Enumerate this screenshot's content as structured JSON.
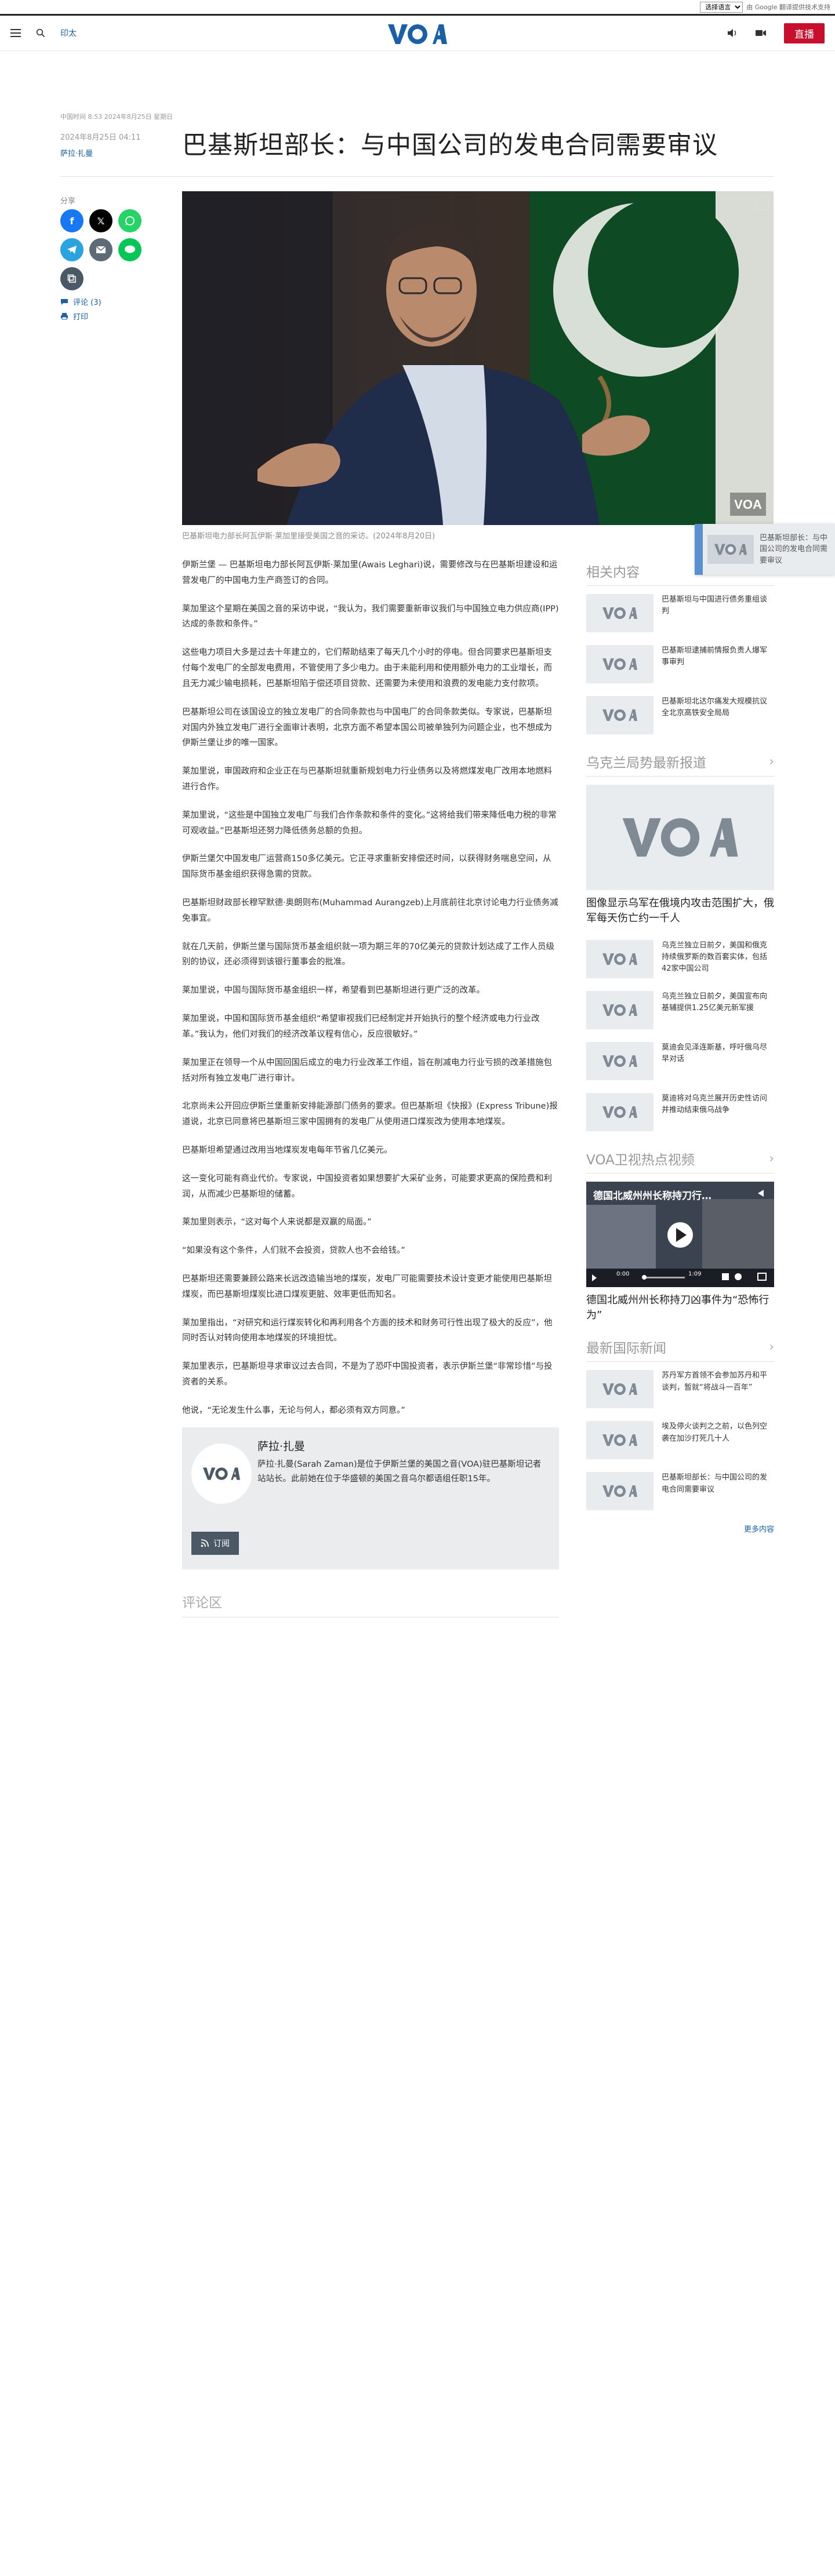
{
  "translate": {
    "select_label": "选择语言",
    "powered": "由 Google 翻译提供技术支持",
    "powered_brand": "翻译"
  },
  "header": {
    "print_label": "印太",
    "live_label": "直播",
    "logo_text": "VOA"
  },
  "meta": {
    "timezone_line": "中国时间 8:53 2024年8月25日 星期日",
    "date": "2024年8月25日 04:11",
    "author": "萨拉·扎曼"
  },
  "headline": "巴基斯坦部长：与中国公司的发电合同需要审议",
  "share": {
    "label": "分享",
    "comments": "评论 (3)",
    "print": "打印"
  },
  "hero_caption": "巴基斯坦电力部长阿瓦伊斯·莱加里接受美国之音的采访。(2024年8月20日)",
  "article": [
    "伊斯兰堡 — 巴基斯坦电力部长阿瓦伊斯·莱加里(Awais Leghari)说，需要修改与在巴基斯坦建设和运营发电厂的中国电力生产商签订的合同。",
    "莱加里这个星期在美国之音的采访中说，“我认为，我们需要重新审议我们与中国独立电力供应商(IPP)达成的条款和条件。”",
    "这些电力项目大多是过去十年建立的，它们帮助结束了每天几个小时的停电。但合同要求巴基斯坦支付每个发电厂的全部发电费用，不管使用了多少电力。由于未能利用和使用额外电力的工业增长，而且无力减少输电损耗，巴基斯坦陷于偿还项目贷款、还需要为未使用和浪费的发电能力支付款项。",
    "巴基斯坦公司在该国设立的独立发电厂的合同条款也与中国电厂的合同条款类似。专家说，巴基斯坦对国内外独立发电厂进行全面审计表明，北京方面不希望本国公司被单独列为问题企业，也不想成为伊斯兰堡让步的唯一国家。",
    "莱加里说，审国政府和企业正在与巴基斯坦就重新规划电力行业债务以及将燃煤发电厂改用本地燃料进行合作。",
    "莱加里说，“这些是中国独立发电厂与我们合作条款和条件的变化。”这将给我们带来降低电力税的非常可观收益。”巴基斯坦还努力降低债务总额的负担。",
    "伊斯兰堡欠中国发电厂运营商150多亿美元。它正寻求重新安排偿还时间，以获得财务喘息空间，从国际货币基金组织获得急需的贷款。",
    "巴基斯坦财政部长穆罕默德·奥朗则布(Muhammad Aurangzeb)上月底前往北京讨论电力行业债务减免事宜。",
    "就在几天前，伊斯兰堡与国际货币基金组织就一项为期三年的70亿美元的贷款计划达成了工作人员级别的协议，还必须得到该银行董事会的批准。",
    "莱加里说，中国与国际货币基金组织一样，希望看到巴基斯坦进行更广泛的改革。",
    "莱加里说，中国和国际货币基金组织“希望审视我们已经制定并开始执行的整个经济或电力行业改革。”我认为，他们对我们的经济改革议程有信心，反应很敏好。”",
    "莱加里正在领导一个从中国回国后成立的电力行业改革工作组，旨在削减电力行业亏损的改革措施包括对所有独立发电厂进行审计。",
    "北京尚未公开回应伊斯兰堡重新安排能源部门债务的要求。但巴基斯坦《快报》(Express Tribune)报道说，北京已同意将巴基斯坦三家中国拥有的发电厂从使用进口煤炭改为使用本地煤炭。",
    "巴基斯坦希望通过改用当地煤炭发电每年节省几亿美元。",
    "这一变化可能有商业代价。专家说，中国投资者如果想要扩大采矿业务，可能要求更高的保险费和利润，从而减少巴基斯坦的储蓄。",
    "莱加里则表示，“这对每个人来说都是双赢的局面。”",
    "“如果没有这个条件，人们就不会投资，贷款人也不会给钱。”",
    "巴基斯坦还需要兼顾公路来长远改造输当地的煤炭，发电厂可能需要技术设计变更才能使用巴基斯坦煤炭，而巴基斯坦煤炭比进口煤炭更脏、效率更低而知名。",
    "莱加里指出，“对研究和运行煤炭转化和再利用各个方面的技术和财务可行性出现了极大的反应”，他同时否认对转向使用本地煤炭的环境担忧。",
    "莱加里表示，巴基斯坦寻求审议过去合同，不是为了恐吓中国投资者，表示伊斯兰堡“非常珍惜”与投资者的关系。",
    "他说，“无论发生什么事，无论与何人，都必须有双方同意。”"
  ],
  "bio": {
    "name": "萨拉·扎曼",
    "text": "萨拉·扎曼(Sarah Zaman)是位于伊斯兰堡的美国之音(VOA)驻巴基斯坦记者站站长。此前她在位于华盛顿的美国之音乌尔都语组任职15年。",
    "subscribe": "订阅"
  },
  "comments_title": "评论区",
  "sidebar": {
    "related_title": "相关内容",
    "related": [
      "巴基斯坦与中国进行债务重组谈判",
      "巴基斯坦逮捕前情报负责人爆军事审判",
      "巴基斯坦北达尔痛发大规模抗议全北京高铁安全局局",
      ""
    ],
    "ukraine_title": "乌克兰局势最新报道",
    "ukraine_feature": "图像显示乌军在俄境内攻击范围扩大，俄军每天伤亡约一千人",
    "ukraine": [
      "乌克兰独立日前夕，美国和俄克持续俄罗斯的数百套实体，包括42家中国公司",
      "乌克兰独立日前夕，美国宣布向基辅提供1.25亿美元新军援",
      "莫迪会见泽连斯基，呼吁俄乌尽早对话",
      "莫迪将对乌克兰展开历史性访问 并推动结束俄乌战争"
    ],
    "video_title": "VOA卫视热点视频",
    "video_overlay": "德国北威州州长称持刀行…",
    "video_time": "0:00",
    "video_duration": "1:09",
    "video_caption": "德国北威州州长称持刀凶事件为“恐怖行为”",
    "news_title": "最新国际新闻",
    "news": [
      "苏丹军方首领不会参加苏丹和平谈判，暂就“将战斗一百年”",
      "埃及停火谈判之之前，以色列空袭在加沙打死几十人",
      "巴基斯坦部长：与中国公司的发电合同需要审议"
    ],
    "more": "更多内容"
  },
  "mini_player": {
    "text": "巴基斯坦部长：与中国公司的发电合同需要审议"
  }
}
